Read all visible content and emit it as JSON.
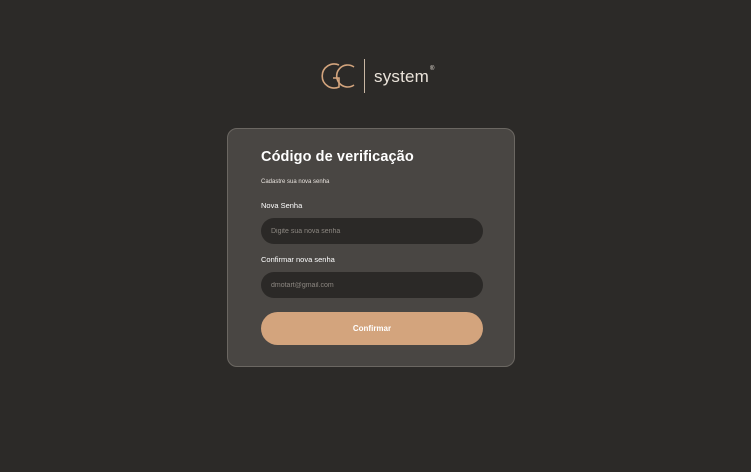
{
  "logo": {
    "mark_letters": "GC",
    "text": "system",
    "registered": "®",
    "color": "#d3a47d"
  },
  "form": {
    "title": "Código de verificação",
    "subtitle": "Cadastre sua nova senha",
    "new_password": {
      "label": "Nova Senha",
      "placeholder": "Digite sua nova senha",
      "value": ""
    },
    "confirm_password": {
      "label": "Confirmar nova senha",
      "placeholder": "dmotart@gmail.com",
      "value": ""
    },
    "submit_label": "Confirmar"
  },
  "colors": {
    "background": "#2c2a28",
    "card": "#494643",
    "input": "#2b2927",
    "accent": "#d3a47d"
  }
}
